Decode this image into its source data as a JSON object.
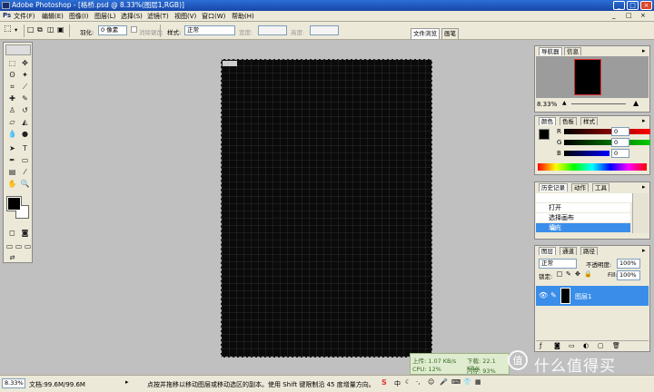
{
  "window": {
    "title": "Adobe Photoshop - [格桥.psd @ 8.33%(图层1,RGB)]",
    "controls": [
      "_",
      "□",
      "×"
    ]
  },
  "menu": [
    "文件(F)",
    "编辑(E)",
    "图像(I)",
    "图层(L)",
    "选择(S)",
    "滤镜(T)",
    "视图(V)",
    "窗口(W)",
    "帮助(H)"
  ],
  "options": {
    "feather_label": "羽化:",
    "feather_value": "0 像素",
    "antialias_label": "消除锯齿",
    "style_label": "样式:",
    "style_value": "正常",
    "width_label": "宽度:",
    "height_label": "高度:",
    "palette_tabs": [
      "文件浏览",
      "画笔"
    ]
  },
  "navigator": {
    "tabs": [
      "导航器",
      "信息"
    ],
    "zoom": "8.33%"
  },
  "color": {
    "tabs": [
      "颜色",
      "色板",
      "样式"
    ],
    "channels": [
      {
        "label": "R",
        "value": "0"
      },
      {
        "label": "G",
        "value": "0"
      },
      {
        "label": "B",
        "value": "0"
      }
    ]
  },
  "history": {
    "tabs": [
      "历史记录",
      "动作",
      "工具"
    ],
    "items": [
      "打开",
      "选择画布",
      "填充"
    ],
    "selected_index": 2
  },
  "layers": {
    "tabs": [
      "图层",
      "通道",
      "路径"
    ],
    "blend_mode": "正常",
    "opacity_label": "不透明度:",
    "opacity": "100%",
    "lock_label": "锁定:",
    "fill_label": "Fill:",
    "fill": "100%",
    "layer_name": "图层1"
  },
  "status": {
    "zoom": "8.33%",
    "doc_info": "文档:99.6M/99.6M",
    "hint": "点按并拖移以移动图层或移动选区的副本。使用 Shift 键限制沿 45 度增量方向。"
  },
  "network": {
    "upload": "上传: 1.07 KB/s",
    "download": "下载: 22.1 KB/s",
    "cpu": "CPU: 12%",
    "memory": "内存: 93%"
  },
  "taskbar_ime": "中",
  "watermark": "什么值得买"
}
